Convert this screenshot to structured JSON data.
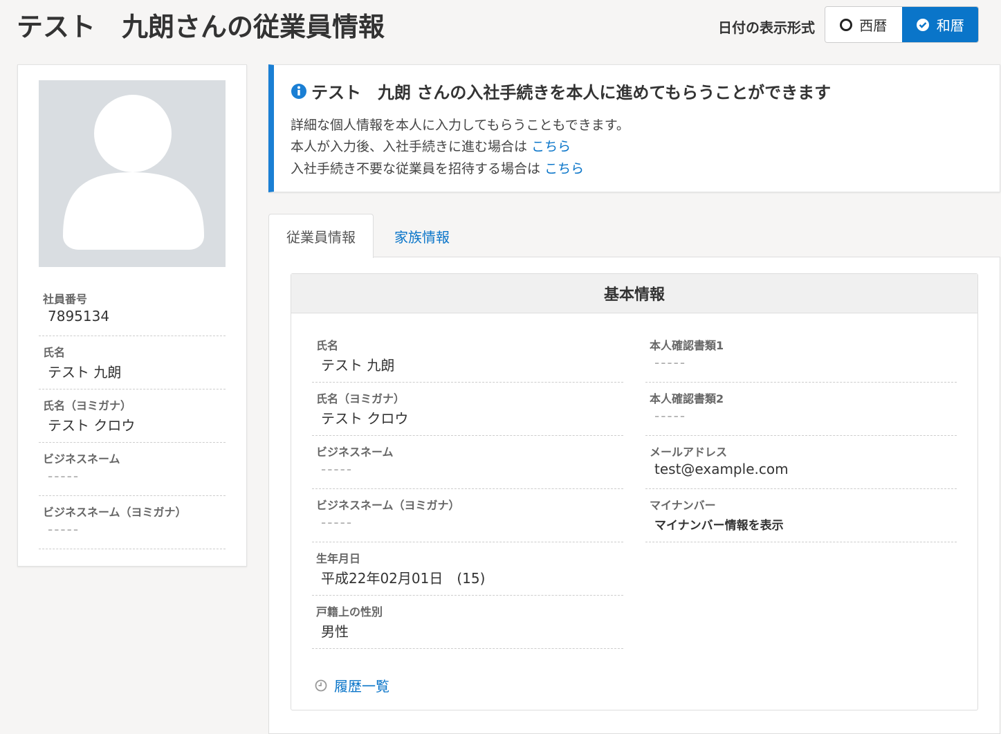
{
  "header": {
    "title": "テスト　九朗さんの従業員情報",
    "date_format_label": "日付の表示形式",
    "options": [
      {
        "label": "西暦",
        "selected": false
      },
      {
        "label": "和暦",
        "selected": true
      }
    ]
  },
  "colors": {
    "accent": "#0a75c9",
    "info_border": "#1a7fd4"
  },
  "sidebar": {
    "fields": [
      {
        "label": "社員番号",
        "value": "7895134"
      },
      {
        "label": "氏名",
        "value": "テスト 九朗"
      },
      {
        "label": "氏名（ヨミガナ）",
        "value": "テスト クロウ"
      },
      {
        "label": "ビジネスネーム",
        "value": "-----"
      },
      {
        "label": "ビジネスネーム（ヨミガナ）",
        "value": "-----"
      }
    ]
  },
  "notice": {
    "title": "テスト　九朗 さんの入社手続きを本人に進めてもらうことができます",
    "line1": "詳細な個人情報を本人に入力してもらうこともできます。",
    "line2": "本人が入力後、入社手続きに進む場合は",
    "line3": "入社手続き不要な従業員を招待する場合は",
    "link": "こちら"
  },
  "tabs": [
    {
      "label": "従業員情報",
      "active": true
    },
    {
      "label": "家族情報",
      "active": false
    }
  ],
  "basic": {
    "title": "基本情報",
    "left": [
      {
        "label": "氏名",
        "value": "テスト 九朗"
      },
      {
        "label": "氏名（ヨミガナ）",
        "value": "テスト クロウ"
      },
      {
        "label": "ビジネスネーム",
        "value": "-----"
      },
      {
        "label": "ビジネスネーム（ヨミガナ）",
        "value": "-----"
      },
      {
        "label": "生年月日",
        "value": "平成22年02月01日　(15)"
      },
      {
        "label": "戸籍上の性別",
        "value": "男性"
      }
    ],
    "right": [
      {
        "label": "本人確認書類1",
        "value": "-----"
      },
      {
        "label": "本人確認書類2",
        "value": "-----"
      },
      {
        "label": "メールアドレス",
        "value": "test@example.com"
      },
      {
        "label": "マイナンバー",
        "value": "マイナンバー情報を表示"
      }
    ],
    "history": "履歴一覧"
  }
}
